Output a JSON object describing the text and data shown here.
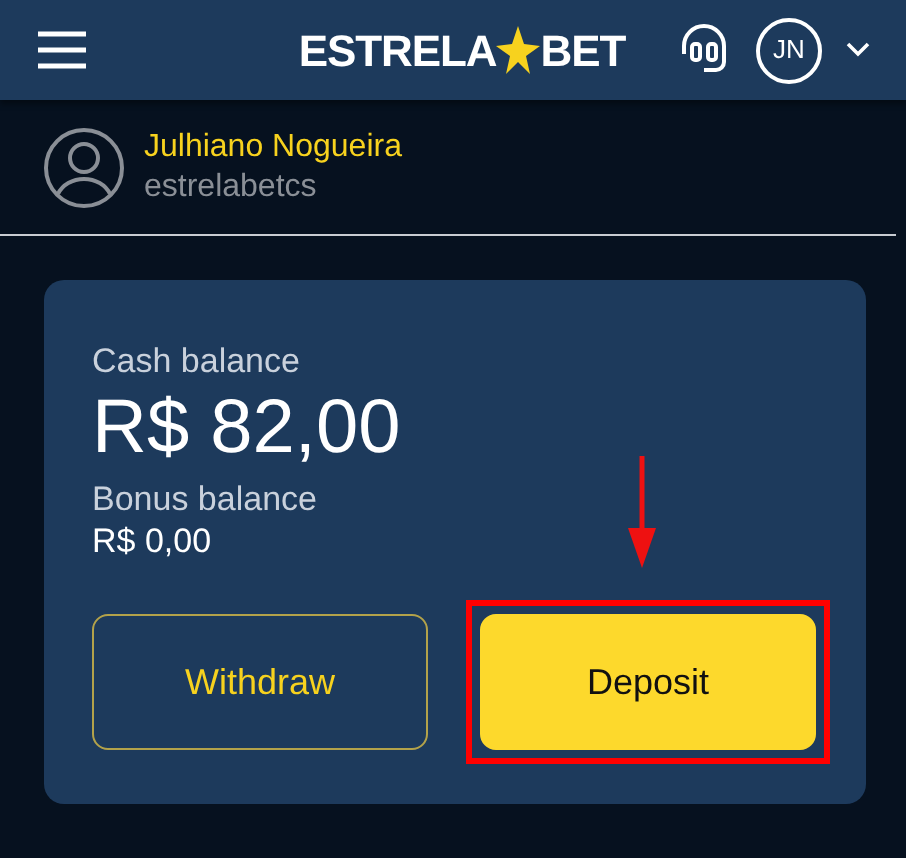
{
  "header": {
    "logo": {
      "left": "ESTRELA",
      "right": "BET"
    },
    "avatar_initials": "JN"
  },
  "profile": {
    "name": "Julhiano Nogueira",
    "username": "estrelabetcs"
  },
  "balance_card": {
    "cash_label": "Cash balance",
    "cash_amount": "R$ 82,00",
    "bonus_label": "Bonus balance",
    "bonus_amount": "R$ 0,00",
    "buttons": [
      {
        "label": "Withdraw",
        "kind": "outline",
        "highlighted": false
      },
      {
        "label": "Deposit",
        "kind": "filled",
        "highlighted": true
      }
    ]
  }
}
